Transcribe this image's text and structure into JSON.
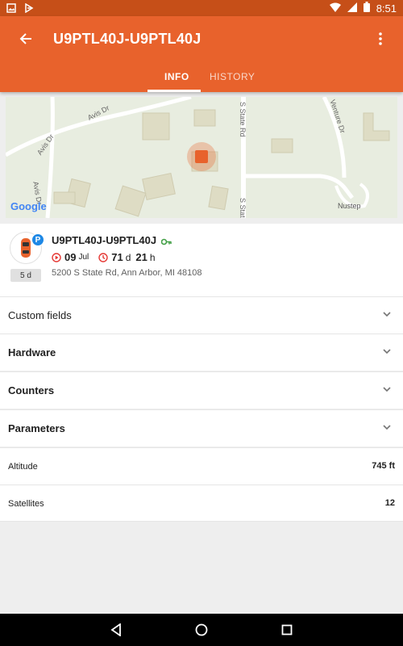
{
  "status_bar": {
    "time": "8:51"
  },
  "app_bar": {
    "title": "U9PTL40J-U9PTL40J",
    "tabs": [
      {
        "label": "INFO",
        "active": true
      },
      {
        "label": "HISTORY",
        "active": false
      }
    ]
  },
  "map": {
    "streets": [
      "Avis Dr",
      "Avis Dr",
      "Avis Dr",
      "S State Rd",
      "S State Rd",
      "Venture Dr"
    ],
    "place": "Nustep",
    "attribution": "Google"
  },
  "device": {
    "name": "U9PTL40J-U9PTL40J",
    "parking_badge": "P",
    "days_badge": "5 d",
    "date_day": "09",
    "date_month": "Jul",
    "duration_days": "71",
    "duration_days_unit": "d",
    "duration_hours": "21",
    "duration_hours_unit": "h",
    "address": "5200 S State Rd, Ann Arbor, MI 48108"
  },
  "sections": {
    "custom_fields": "Custom fields",
    "hardware": "Hardware",
    "counters": "Counters",
    "parameters": "Parameters"
  },
  "rows": {
    "altitude_label": "Altitude",
    "altitude_value": "745 ft",
    "satellites_label": "Satellites",
    "satellites_value": "12"
  },
  "colors": {
    "accent": "#e8622c",
    "status_bar": "#c64f18",
    "marker": "#e8622c",
    "parking": "#1e88e5",
    "key": "#43a047"
  },
  "icons": {
    "back": "arrow-left",
    "more": "more-vertical",
    "key": "key",
    "play": "play-circle",
    "clock": "clock"
  }
}
